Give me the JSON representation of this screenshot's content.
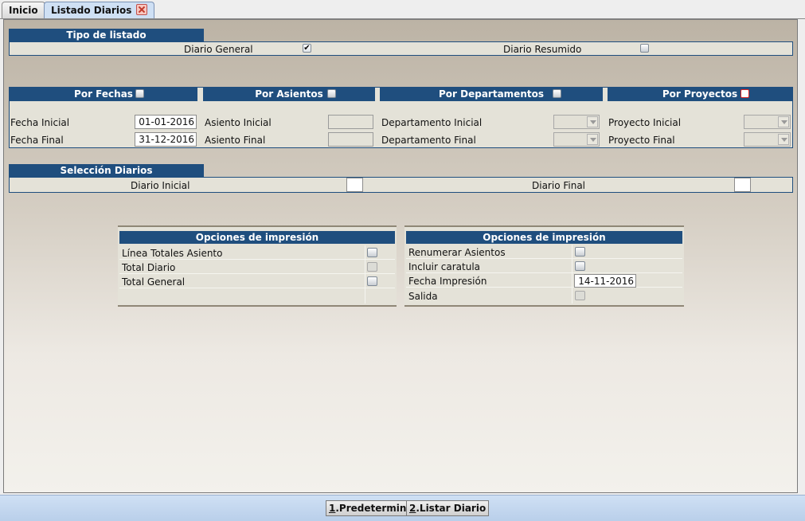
{
  "tabs": [
    {
      "label": "Inicio"
    },
    {
      "label": "Listado Diarios"
    }
  ],
  "tipo_listado": {
    "header": "Tipo de listado",
    "diario_general": {
      "label": "Diario General",
      "checked": true
    },
    "diario_resumido": {
      "label": "Diario Resumido",
      "checked": false
    }
  },
  "filters": {
    "por_fechas": {
      "header": "Por Fechas",
      "fecha_inicial_label": "Fecha Inicial",
      "fecha_inicial_value": "01-01-2016",
      "fecha_final_label": "Fecha Final",
      "fecha_final_value": "31-12-2016"
    },
    "por_asientos": {
      "header": "Por Asientos",
      "inicial_label": "Asiento Inicial",
      "final_label": "Asiento Final"
    },
    "por_departamentos": {
      "header": "Por Departamentos",
      "inicial_label": "Departamento Inicial",
      "final_label": "Departamento Final"
    },
    "por_proyectos": {
      "header": "Por Proyectos",
      "inicial_label": "Proyecto Inicial",
      "final_label": "Proyecto Final"
    }
  },
  "seleccion_diarios": {
    "header": "Selección Diarios",
    "inicial_label": "Diario Inicial",
    "final_label": "Diario Final"
  },
  "opciones_left": {
    "header": "Opciones de impresión",
    "rows": [
      "Línea Totales Asiento",
      "Total Diario",
      "Total General"
    ]
  },
  "opciones_right": {
    "header": "Opciones de impresión",
    "rows": [
      "Renumerar Asientos",
      "Incluir caratula",
      "Fecha Impresión",
      "Salida"
    ],
    "fecha_impresion_value": "14-11-2016"
  },
  "buttons": {
    "predeterminar": {
      "mnemonic": "1",
      "rest": ".Predeterminar"
    },
    "listar": {
      "mnemonic": "2",
      "rest": ".Listar Diario"
    }
  },
  "colors": {
    "header_bg": "#1f4e7e",
    "tab_active_bg": "#cfe0f4"
  }
}
